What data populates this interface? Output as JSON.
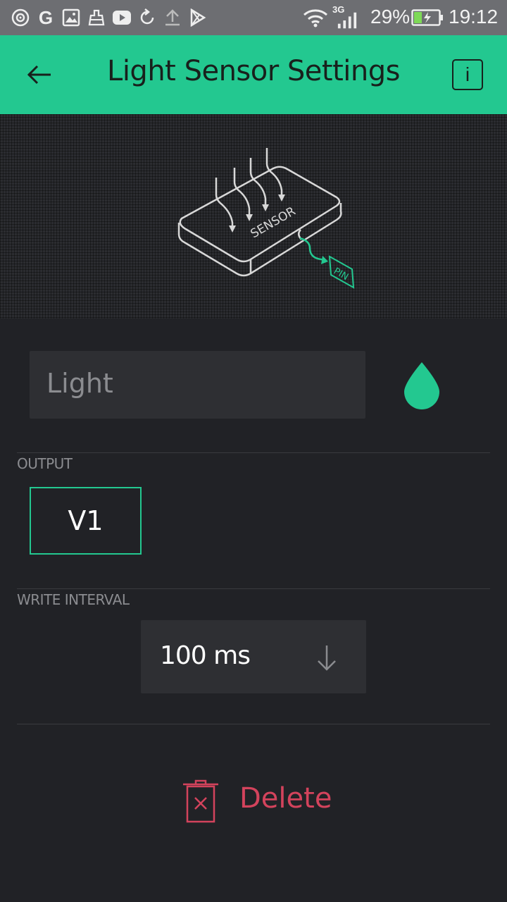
{
  "status_bar": {
    "battery_percent": "29%",
    "network_type": "3G",
    "time": "19:12",
    "notification_icons": [
      "hotspot-icon",
      "google-icon",
      "image-icon",
      "cleaner-icon",
      "youtube-icon",
      "sync-icon",
      "upload-icon",
      "play-store-icon"
    ]
  },
  "app_bar": {
    "title": "Light Sensor Settings",
    "info_label": "i"
  },
  "illustration": {
    "sensor_label": "SENSOR",
    "pin_label": "PIN"
  },
  "name_field": {
    "placeholder": "Light"
  },
  "colors": {
    "accent": "#23c890",
    "background": "#212226",
    "field": "#2e2f33",
    "danger": "#d3435c"
  },
  "output": {
    "label": "OUTPUT",
    "pin_value": "V1"
  },
  "write_interval": {
    "label": "WRITE INTERVAL",
    "value": "100 ms"
  },
  "delete": {
    "label": "Delete"
  }
}
